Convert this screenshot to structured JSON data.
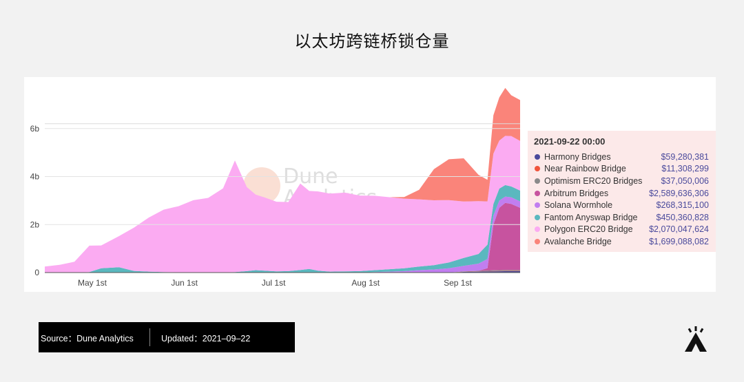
{
  "title": "以太坊跨链桥锁仓量",
  "chart_data": {
    "type": "area",
    "stacked": true,
    "ylim": [
      0,
      7800000000
    ],
    "y_ticks": [
      {
        "value": 0,
        "label": "0"
      },
      {
        "value": 2000000000,
        "label": "2b"
      },
      {
        "value": 4000000000,
        "label": "4b"
      },
      {
        "value": 6000000000,
        "label": "6b"
      }
    ],
    "x_ticks": [
      {
        "date": "2021-05-01",
        "label": "May 1st"
      },
      {
        "date": "2021-06-01",
        "label": "Jun 1st"
      },
      {
        "date": "2021-07-01",
        "label": "Jul 1st"
      },
      {
        "date": "2021-08-01",
        "label": "Aug 1st"
      },
      {
        "date": "2021-09-01",
        "label": "Sep 1st"
      }
    ],
    "x_range": [
      "2021-04-15",
      "2021-09-22"
    ],
    "hover_date": "2021-09-19",
    "dates": [
      "2021-04-15",
      "2021-04-20",
      "2021-04-25",
      "2021-04-30",
      "2021-05-04",
      "2021-05-10",
      "2021-05-15",
      "2021-05-20",
      "2021-05-25",
      "2021-05-30",
      "2021-06-04",
      "2021-06-09",
      "2021-06-14",
      "2021-06-18",
      "2021-06-22",
      "2021-06-25",
      "2021-06-28",
      "2021-07-02",
      "2021-07-06",
      "2021-07-10",
      "2021-07-13",
      "2021-07-16",
      "2021-07-20",
      "2021-07-25",
      "2021-07-30",
      "2021-08-04",
      "2021-08-09",
      "2021-08-14",
      "2021-08-19",
      "2021-08-24",
      "2021-08-29",
      "2021-09-03",
      "2021-09-08",
      "2021-09-11",
      "2021-09-13",
      "2021-09-15",
      "2021-09-17",
      "2021-09-19",
      "2021-09-22"
    ],
    "series": [
      {
        "name": "Harmony Bridges",
        "color": "#4b4a9c",
        "values": [
          0,
          0,
          0,
          0,
          0,
          0,
          0,
          0,
          0,
          0,
          0,
          0,
          0,
          0,
          0,
          0,
          0,
          0,
          0,
          0,
          0,
          0,
          0,
          0,
          0,
          0,
          0,
          0,
          0,
          0,
          0,
          30000000,
          40000000,
          45000000,
          50000000,
          55000000,
          58000000,
          60000000,
          59280381
        ]
      },
      {
        "name": "Near Rainbow Bridge",
        "color": "#f0543c",
        "values": [
          0,
          0,
          0,
          0,
          0,
          0,
          0,
          0,
          0,
          0,
          0,
          0,
          0,
          0,
          0,
          0,
          0,
          0,
          0,
          0,
          0,
          0,
          0,
          0,
          0,
          0,
          0,
          0,
          0,
          0,
          0,
          5000000,
          8000000,
          9000000,
          10000000,
          10000000,
          11000000,
          11000000,
          11308299
        ]
      },
      {
        "name": "Optimism ERC20 Bridges",
        "color": "#8a8a8a",
        "values": [
          0,
          0,
          0,
          0,
          0,
          0,
          0,
          0,
          0,
          0,
          0,
          0,
          0,
          0,
          0,
          0,
          0,
          0,
          0,
          0,
          0,
          0,
          0,
          0,
          0,
          0,
          0,
          0,
          0,
          0,
          0,
          15000000,
          25000000,
          30000000,
          32000000,
          34000000,
          36000000,
          37000000,
          37050006
        ]
      },
      {
        "name": "Arbitrum Bridges",
        "color": "#c7539f",
        "values": [
          0,
          0,
          0,
          0,
          0,
          0,
          0,
          0,
          0,
          0,
          0,
          0,
          0,
          0,
          0,
          0,
          0,
          0,
          0,
          0,
          0,
          0,
          0,
          0,
          0,
          0,
          0,
          0,
          0,
          0,
          0,
          0,
          0,
          100000000,
          1900000000,
          2600000000,
          2800000000,
          2750000000,
          2589636306
        ]
      },
      {
        "name": "Solana Wormhole",
        "color": "#c17ef0",
        "values": [
          0,
          0,
          0,
          0,
          0,
          0,
          0,
          0,
          0,
          0,
          0,
          0,
          0,
          0,
          0,
          0,
          0,
          0,
          0,
          0,
          0,
          0,
          0,
          0,
          0,
          20000000,
          40000000,
          60000000,
          100000000,
          130000000,
          180000000,
          230000000,
          300000000,
          380000000,
          380000000,
          300000000,
          260000000,
          280000000,
          268315100
        ]
      },
      {
        "name": "Fantom Anyswap Bridge",
        "color": "#5ab8bf",
        "values": [
          0,
          0,
          0,
          20000000,
          180000000,
          220000000,
          70000000,
          40000000,
          20000000,
          15000000,
          15000000,
          10000000,
          10000000,
          20000000,
          60000000,
          100000000,
          80000000,
          50000000,
          60000000,
          110000000,
          150000000,
          80000000,
          40000000,
          50000000,
          60000000,
          80000000,
          100000000,
          120000000,
          150000000,
          180000000,
          240000000,
          330000000,
          400000000,
          600000000,
          480000000,
          500000000,
          480000000,
          450000000,
          450360828
        ]
      },
      {
        "name": "Polygon ERC20 Bridge",
        "color": "#fbabf2",
        "values": [
          250000000,
          320000000,
          450000000,
          1100000000,
          950000000,
          1300000000,
          1800000000,
          2250000000,
          2600000000,
          2750000000,
          3000000000,
          3100000000,
          3500000000,
          4650000000,
          3500000000,
          3150000000,
          3050000000,
          2900000000,
          2880000000,
          3600000000,
          3250000000,
          3300000000,
          3250000000,
          3280000000,
          3150000000,
          3100000000,
          3000000000,
          2900000000,
          2800000000,
          2700000000,
          2600000000,
          2350000000,
          2200000000,
          1800000000,
          2100000000,
          2000000000,
          2050000000,
          2100000000,
          2070047624
        ]
      },
      {
        "name": "Avalanche Bridge",
        "color": "#fa847a",
        "values": [
          0,
          0,
          0,
          0,
          0,
          0,
          0,
          0,
          0,
          0,
          0,
          0,
          0,
          0,
          0,
          0,
          0,
          0,
          0,
          0,
          0,
          0,
          0,
          0,
          0,
          0,
          0,
          70000000,
          400000000,
          1300000000,
          1700000000,
          1800000000,
          1100000000,
          900000000,
          1600000000,
          1800000000,
          2000000000,
          1700000000,
          1699088082
        ]
      }
    ],
    "tooltip": {
      "time": "2021-09-22 00:00",
      "rows": [
        {
          "name": "Harmony Bridges",
          "color": "#4b4a9c",
          "value": "$59,280,381"
        },
        {
          "name": "Near Rainbow Bridge",
          "color": "#f0543c",
          "value": "$11,308,299"
        },
        {
          "name": "Optimism ERC20 Bridges",
          "color": "#8a8a8a",
          "value": "$37,050,006"
        },
        {
          "name": "Arbitrum Bridges",
          "color": "#c7539f",
          "value": "$2,589,636,306"
        },
        {
          "name": "Solana Wormhole",
          "color": "#c17ef0",
          "value": "$268,315,100"
        },
        {
          "name": "Fantom Anyswap Bridge",
          "color": "#5ab8bf",
          "value": "$450,360,828"
        },
        {
          "name": "Polygon ERC20 Bridge",
          "color": "#fbabf2",
          "value": "$2,070,047,624"
        },
        {
          "name": "Avalanche Bridge",
          "color": "#fa847a",
          "value": "$1,699,088,082"
        }
      ]
    },
    "watermark": [
      "Dune",
      "Analytics"
    ]
  },
  "footer": {
    "source": "Source：Dune Analytics",
    "updated": "Updated：2021–09–22"
  }
}
